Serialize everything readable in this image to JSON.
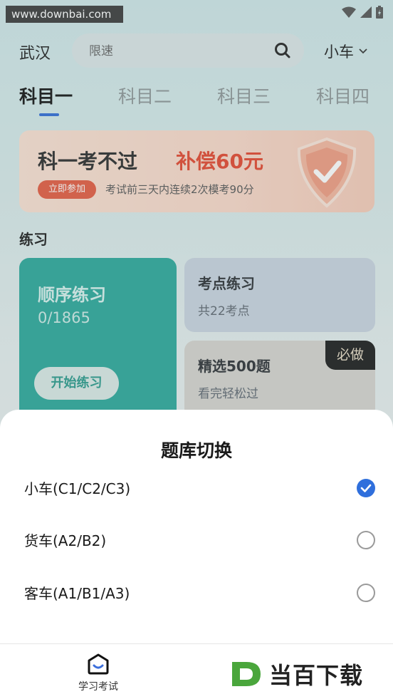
{
  "status_bar": {
    "watermark": "www.downbai.com"
  },
  "header": {
    "city": "武汉",
    "search": {
      "placeholder": "限速"
    },
    "vehicle": "小车"
  },
  "tabs": [
    {
      "label": "科目一",
      "active": true
    },
    {
      "label": "科目二",
      "active": false
    },
    {
      "label": "科目三",
      "active": false
    },
    {
      "label": "科目四",
      "active": false
    }
  ],
  "banner": {
    "title": "科一考不过",
    "highlight": "补偿60元",
    "button": "立即参加",
    "description": "考试前三天内连续2次模考90分"
  },
  "practice": {
    "section_title": "练习",
    "sequential": {
      "title": "顺序练习",
      "progress": "0/1865",
      "button": "开始练习"
    },
    "key_points": {
      "title": "考点练习",
      "subtitle": "共22考点"
    },
    "selected": {
      "title": "精选500题",
      "subtitle": "看完轻松过",
      "badge": "必做"
    }
  },
  "sheet": {
    "title": "题库切换",
    "options": [
      {
        "label": "小车(C1/C2/C3)",
        "selected": true
      },
      {
        "label": "货车(A2/B2)",
        "selected": false
      },
      {
        "label": "客车(A1/B1/A3)",
        "selected": false
      }
    ]
  },
  "bottom_nav": {
    "home_label": "学习考试"
  },
  "brand_watermark": {
    "letter": "D",
    "text": "当百下载"
  },
  "colors": {
    "accent": "#2f6fdc",
    "teal": "#2aa89a",
    "banner_red": "#e4452c"
  }
}
